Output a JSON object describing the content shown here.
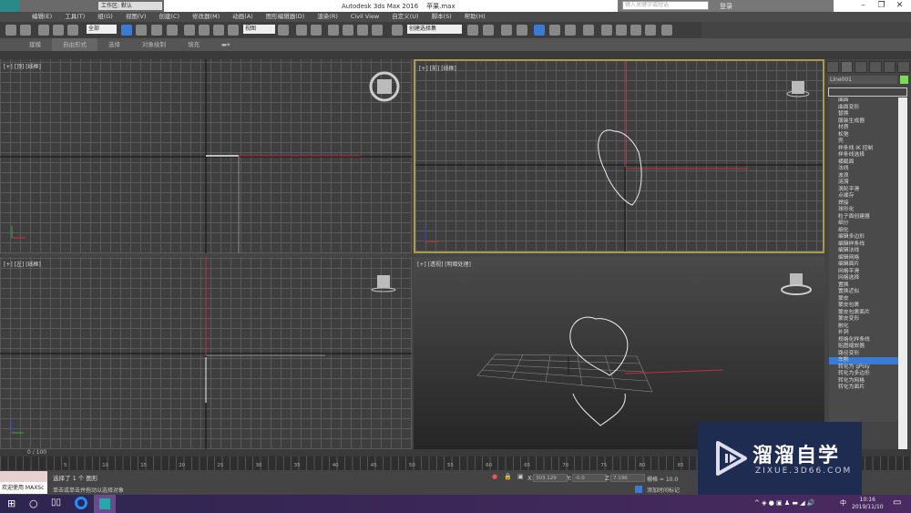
{
  "app": {
    "title": "Autodesk 3ds Max 2016",
    "file": "苹果.max",
    "workspace": "工作区: 默认",
    "logo": "MAX"
  },
  "search": {
    "placeholder": "键入关键字或短语"
  },
  "user": {
    "login": "登录"
  },
  "menu": [
    "编辑(E)",
    "工具(T)",
    "组(G)",
    "视图(V)",
    "创建(C)",
    "修改器(M)",
    "动画(A)",
    "图形编辑器(D)",
    "渲染(R)",
    "Civil View",
    "自定义(U)",
    "脚本(S)",
    "帮助(H)"
  ],
  "toolbar": {
    "filter": "全部",
    "refcoord": "视图",
    "selset": "创建选择集"
  },
  "ribbon": [
    "建模",
    "自由形式",
    "选择",
    "对象绘制",
    "填充"
  ],
  "viewports": {
    "top": "[+] [顶] [线框]",
    "front": "[+] [前] [线框]",
    "left": "[+] [左] [线框]",
    "persp": "[+] [透视] [明暗处理]"
  },
  "command_panel": {
    "object_name": "Line001",
    "object_color": "#7ed957",
    "modifiers": [
      "曲面",
      "曲面变形",
      "替换",
      "服装生成器",
      "材质",
      "松弛",
      "壳",
      "样条线 IK 控制",
      "样条线选择",
      "横截面",
      "法线",
      "波浪",
      "涟漪",
      "涡轮平滑",
      "点缓存",
      "焊接",
      "球形化",
      "粒子面创建器",
      "细分",
      "细化",
      "编辑多边形",
      "编辑样条线",
      "编辑法线",
      "编辑网格",
      "编辑面片",
      "网格平滑",
      "网格选择",
      "置换",
      "置换近似",
      "蒙皮",
      "蒙皮包裹",
      "蒙皮包裹面片",
      "蒙皮变形",
      "融化",
      "补洞",
      "规格化样条线",
      "贴图缩放器",
      "路径变形",
      "车削",
      "转化为 gPoly",
      "转化为多边形",
      "转化为网格",
      "转化为面片"
    ],
    "selected_modifier": "车削"
  },
  "timeline": {
    "frame": "0 / 100",
    "ticks": [
      "5",
      "10",
      "15",
      "20",
      "25",
      "30",
      "35",
      "40",
      "45",
      "50",
      "55",
      "60",
      "65",
      "70",
      "75",
      "80",
      "85"
    ]
  },
  "status": {
    "welcome": "欢迎使用 MAXSc",
    "line1": "选择了 1 个 图形",
    "line2": "单击或单击并拖动以选择对象",
    "x": "303.129",
    "y": "-0.0",
    "z": "7.196",
    "grid": "栅格 = 10.0",
    "time_tag": "添加时间标记"
  },
  "taskbar": {
    "time": "10:16",
    "date": "2019/11/10",
    "ime": "中"
  },
  "watermark": {
    "title": "溜溜自学",
    "url": "ZIXUE.3D66.COM"
  }
}
